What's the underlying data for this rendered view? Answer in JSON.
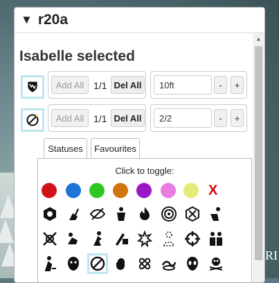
{
  "dialog": {
    "title": "r20a"
  },
  "selection_heading": "Isabelle selected",
  "rows": [
    {
      "add_label": "Add All",
      "count": "1/1",
      "del_label": "Del All",
      "value": "10ft",
      "minus": "-",
      "plus": "+"
    },
    {
      "add_label": "Add All",
      "count": "1/1",
      "del_label": "Del All",
      "value": "2/2",
      "minus": "-",
      "plus": "+"
    }
  ],
  "tabs": [
    {
      "label": "Statuses"
    },
    {
      "label": "Favourites"
    }
  ],
  "panel": {
    "hint": "Click to toggle:"
  },
  "colors": [
    "#d0121b",
    "#1c74d6",
    "#2fc722",
    "#d1760f",
    "#9a17c6",
    "#e87ce0",
    "#e4ec78"
  ],
  "remove_mark": "X",
  "status_icons": [
    "skull-die-icon",
    "shovel-icon",
    "blind-eye-icon",
    "strong-man-icon",
    "fire-icon",
    "target-icon",
    "crossed-swords-icon",
    "archer-icon",
    "broken-shield-icon",
    "crouching-man-icon",
    "running-man-icon",
    "sword-hand-icon",
    "sparkle-icon",
    "dotted-figure-icon",
    "crosshair-icon",
    "two-people-icon",
    "bleeding-man-icon",
    "gargoyle-icon",
    "interdiction-icon",
    "fist-icon",
    "bandage-icon",
    "snake-icon",
    "alien-icon",
    "skull-crossbones-icon"
  ]
}
